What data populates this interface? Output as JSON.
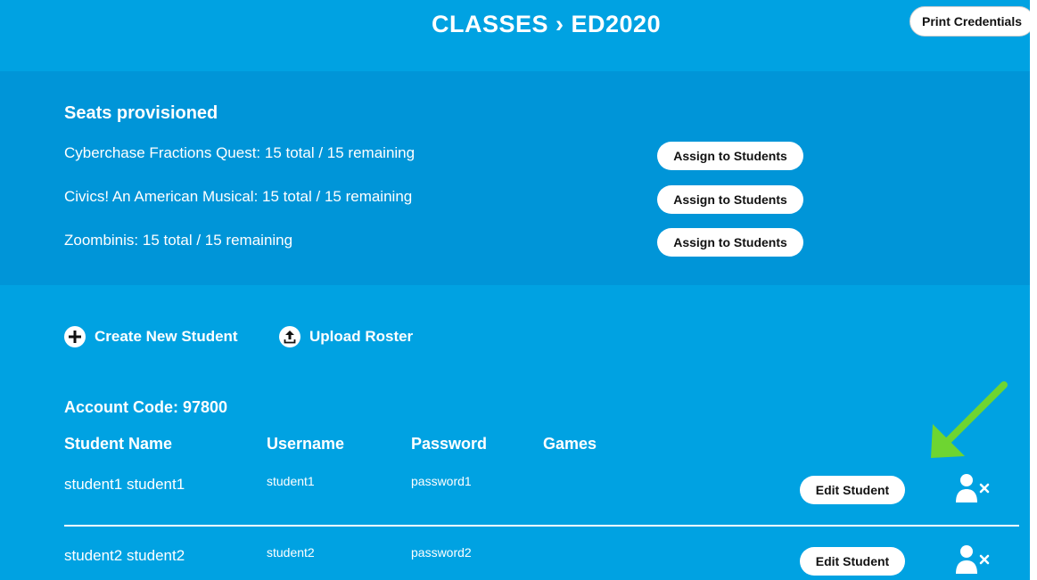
{
  "header": {
    "title": "CLASSES › ED2020",
    "print_label": "Print Credentials"
  },
  "seats": {
    "heading": "Seats provisioned",
    "items": [
      {
        "text": "Cyberchase Fractions Quest: 15 total / 15 remaining",
        "button": "Assign to Students"
      },
      {
        "text": "Civics! An American Musical: 15 total / 15 remaining",
        "button": "Assign to Students"
      },
      {
        "text": "Zoombinis: 15 total / 15 remaining",
        "button": "Assign to Students"
      }
    ]
  },
  "actions": {
    "create_label": "Create New Student",
    "upload_label": "Upload Roster"
  },
  "roster": {
    "account_code": "Account Code: 97800",
    "columns": [
      "Student Name",
      "Username",
      "Password",
      "Games"
    ],
    "rows": [
      {
        "name": "student1 student1",
        "username": "student1",
        "password": "password1",
        "edit": "Edit Student"
      },
      {
        "name": "student2 student2",
        "username": "student2",
        "password": "password2",
        "edit": "Edit Student"
      }
    ]
  },
  "colors": {
    "background": "#00a2e2",
    "seats_panel": "#0095d8",
    "annotation_arrow": "#6ed531"
  },
  "icons": {
    "create": "plus-circle-icon",
    "upload": "upload-circle-icon",
    "remove": "remove-user-icon",
    "annotation": "arrow-icon"
  }
}
